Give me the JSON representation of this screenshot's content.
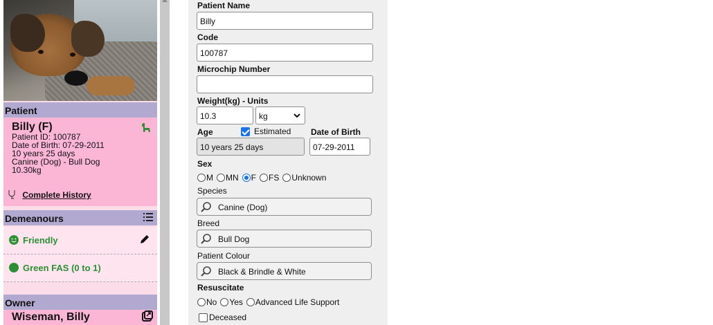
{
  "sidebar": {
    "patient_heading": "Patient",
    "patient": {
      "name": "Billy (F)",
      "id_line": "Patient ID: 100787",
      "dob_line": "Date of Birth: 07-29-2011",
      "age_line": "10 years 25 days",
      "breed_line": "Canine (Dog) - Bull Dog",
      "weight_line": "10.30kg",
      "history_link": "Complete History"
    },
    "demeanours_heading": "Demeanours",
    "demeanours": [
      {
        "label": "Friendly",
        "icon": "smiley-icon",
        "color": "#2c8f34"
      },
      {
        "label": "Green FAS (0 to 1)",
        "icon": "green-dot-icon",
        "color": "#2c8f34"
      }
    ],
    "owner_heading": "Owner",
    "owner_name": "Wiseman, Billy"
  },
  "form": {
    "patient_name_label": "Patient Name",
    "patient_name_value": "Billy",
    "code_label": "Code",
    "code_value": "100787",
    "microchip_label": "Microchip Number",
    "microchip_value": "",
    "weight_label": "Weight(kg) - Units",
    "weight_value": "10.3",
    "unit_value": "kg",
    "age_label": "Age",
    "estimated_label": "Estimated",
    "estimated_checked": true,
    "dob_label": "Date of Birth",
    "age_value": "10 years 25 days",
    "dob_value": "07-29-2011",
    "sex_label": "Sex",
    "sex_options": [
      "M",
      "MN",
      "F",
      "FS",
      "Unknown"
    ],
    "sex_selected": "F",
    "species_label": "Species",
    "species_value": "Canine (Dog)",
    "breed_label": "Breed",
    "breed_value": "Bull Dog",
    "colour_label": "Patient Colour",
    "colour_value": "Black & Brindle & White",
    "resuscitate_label": "Resuscitate",
    "resuscitate_options": [
      "No",
      "Yes",
      "Advanced Life Support"
    ],
    "deceased_label": "Deceased",
    "deceased_checked": false
  },
  "colors": {
    "sidebar_pink": "#fbb6d6",
    "section_header": "#b2a9d0",
    "accent_blue": "#1a73e8",
    "friendly_green": "#2c8f34"
  }
}
